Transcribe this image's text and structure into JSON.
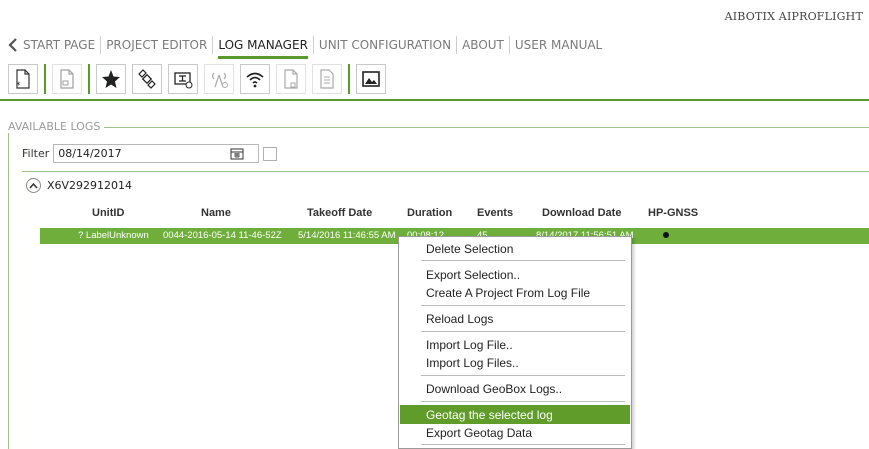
{
  "app": {
    "title": "AIBOTIX AIPROFLIGHT"
  },
  "nav": {
    "items": [
      {
        "label": "START PAGE"
      },
      {
        "label": "PROJECT EDITOR"
      },
      {
        "label": "LOG MANAGER",
        "active": true
      },
      {
        "label": "UNIT CONFIGURATION"
      },
      {
        "label": "ABOUT"
      },
      {
        "label": "USER MANUAL"
      }
    ]
  },
  "toolbar": {
    "icons": [
      "new-document-icon",
      "document-icon",
      "star-icon",
      "satellite-icon",
      "drone-device-icon",
      "antenna-signal-icon",
      "wifi-icon",
      "file-icon",
      "text-file-icon",
      "image-icon"
    ]
  },
  "logs": {
    "group_label": "AVAILABLE LOGS",
    "filter_label": "Filter",
    "filter_date": "08/14/2017",
    "filter_checked": false,
    "device": "X6V292912014",
    "columns": [
      "UnitID",
      "Name",
      "Takeoff Date",
      "Duration",
      "Events",
      "Download Date",
      "HP-GNSS"
    ],
    "rows": [
      {
        "unit_id": "? LabelUnknown",
        "name": "0044-2016-05-14 11-46-52Z",
        "takeoff": "5/14/2016 11:46:55 AM",
        "duration": "00:08:12",
        "events": "45",
        "download": "8/14/2017 11:56:51 AM",
        "hp_gnss": "●"
      }
    ]
  },
  "context_menu": {
    "items": [
      "Delete Selection",
      "Export Selection..",
      "Create A Project From Log File",
      "Reload Logs",
      "Import Log File..",
      "Import Log Files..",
      "Download GeoBox Logs..",
      "Geotag the selected log",
      "Export Geotag Data"
    ],
    "highlighted": "Geotag the selected log"
  },
  "colors": {
    "accent": "#5a9a2c",
    "selected_row": "#6fae3a",
    "highlight": "#5f9c2a"
  }
}
